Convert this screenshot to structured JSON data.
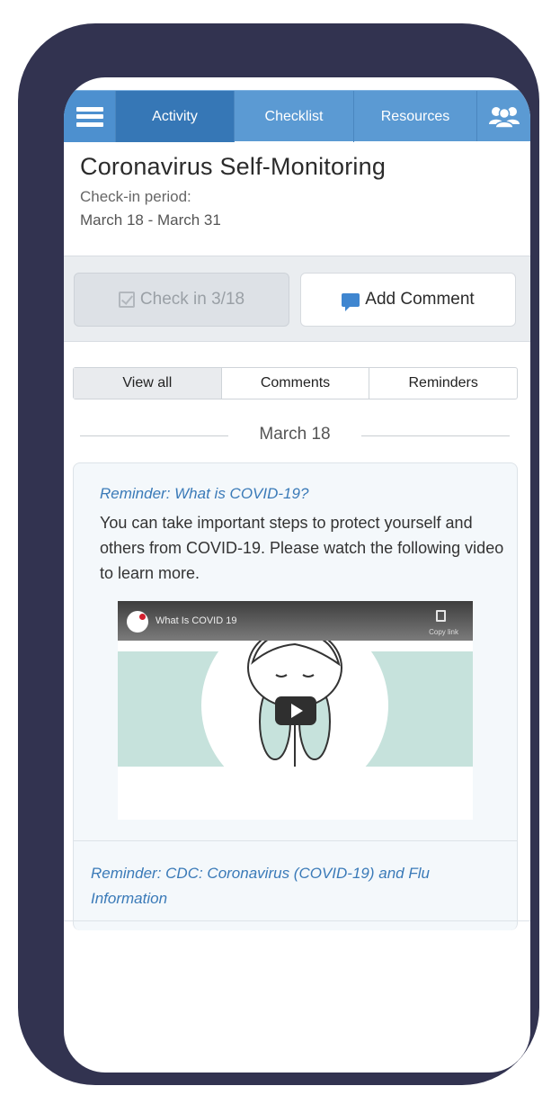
{
  "nav": {
    "tabs": [
      {
        "label": "Activity",
        "active": true
      },
      {
        "label": "Checklist",
        "active": false
      },
      {
        "label": "Resources",
        "active": false
      }
    ],
    "menu_icon": "hamburger-menu-icon",
    "group_icon": "users-group-icon"
  },
  "header": {
    "title": "Coronavirus Self-Monitoring",
    "period_label": "Check-in period:",
    "period_dates": "March 18 - March 31"
  },
  "actions": {
    "checkin_label": "Check in 3/18",
    "comment_label": "Add Comment"
  },
  "filter": {
    "options": [
      "View all",
      "Comments",
      "Reminders"
    ],
    "selected": "View all"
  },
  "feed": {
    "date": "March 18",
    "items": [
      {
        "title": "Reminder: What is COVID-19?",
        "body": "You can take important steps to protect yourself and others from COVID-19. Please watch the following video to learn more.",
        "video": {
          "title": "What Is COVID 19",
          "copy_label": "Copy link"
        }
      },
      {
        "title": "Reminder: CDC: Coronavirus (COVID-19) and Flu Information"
      }
    ]
  },
  "colors": {
    "frame": "#323350",
    "nav": "#5b9ad3",
    "nav_active": "#3677b6",
    "link": "#3a7ab8",
    "video_band": "#c6e2dc"
  }
}
